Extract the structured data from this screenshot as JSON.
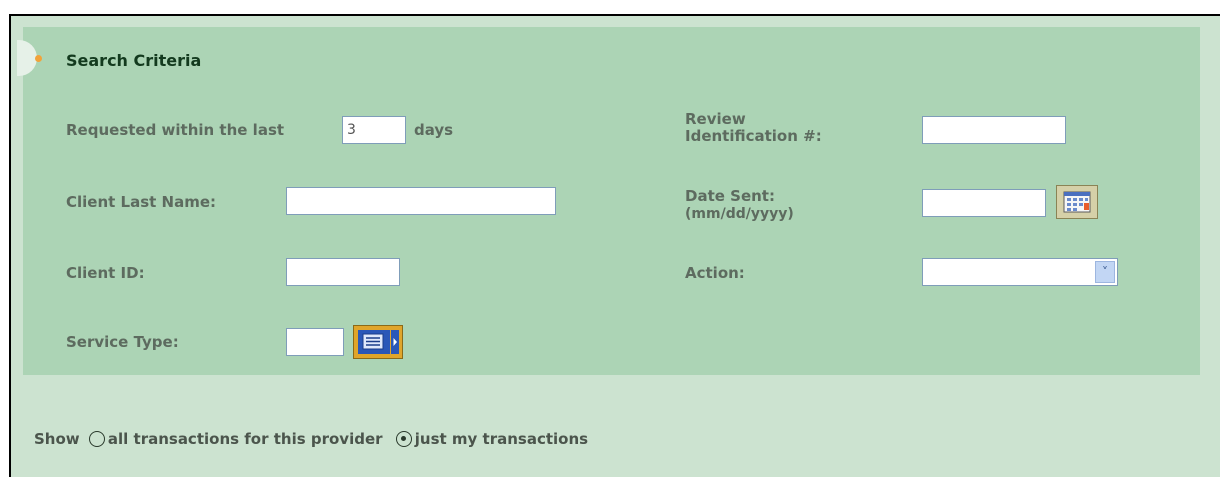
{
  "section": {
    "title": "Search Criteria"
  },
  "requested": {
    "prefix": "Requested within the last",
    "value": "3",
    "suffix": "days"
  },
  "review_id": {
    "label_line1": "Review",
    "label_line2": "Identification #:",
    "value": ""
  },
  "client_last_name": {
    "label": "Client Last Name:",
    "value": ""
  },
  "date_sent": {
    "label": "Date Sent:",
    "format": "(mm/dd/yyyy)",
    "value": ""
  },
  "client_id": {
    "label": "Client ID:",
    "value": ""
  },
  "action": {
    "label": "Action:",
    "selected": "",
    "arrow_icon": "chevron-down-icon"
  },
  "service_type": {
    "label": "Service Type:",
    "value": "",
    "lookup_icon": "list-lookup-icon"
  },
  "show": {
    "label": "Show",
    "options": [
      {
        "label": "all transactions for this provider",
        "selected": false
      },
      {
        "label": "just my transactions",
        "selected": true
      }
    ]
  },
  "colors": {
    "background": "#cce3d0",
    "panel": "#acd4b5",
    "accent": "#f2a33a"
  }
}
